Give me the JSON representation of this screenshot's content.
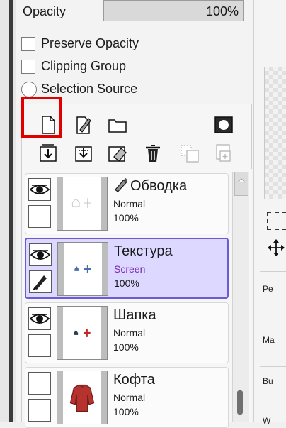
{
  "opacity": {
    "label": "Opacity",
    "value": "100%"
  },
  "options": {
    "preserve_opacity": "Preserve Opacity",
    "clipping_group": "Clipping Group",
    "selection_source": "Selection Source"
  },
  "toolbar": {
    "row1": [
      "new-layer-icon",
      "new-linework-layer-icon",
      "new-folder-icon",
      "layer-mask-icon"
    ],
    "row2": [
      "transfer-down-icon",
      "merge-down-icon",
      "clear-layer-icon",
      "delete-layer-icon",
      "copy-layer-icon",
      "paste-layer-icon"
    ]
  },
  "layers": [
    {
      "name": "Обводка",
      "mode": "Normal",
      "opacity": "100%",
      "visible": true,
      "linework": true,
      "selected": false
    },
    {
      "name": "Текстура",
      "mode": "Screen",
      "opacity": "100%",
      "visible": true,
      "linework": false,
      "selected": true
    },
    {
      "name": "Шапка",
      "mode": "Normal",
      "opacity": "100%",
      "visible": true,
      "linework": false,
      "selected": false
    },
    {
      "name": "Кофта",
      "mode": "Normal",
      "opacity": "100%",
      "visible": false,
      "linework": false,
      "selected": false
    }
  ],
  "right_panel": {
    "labels": [
      "Pe",
      "Ma",
      "Bu",
      "W"
    ]
  },
  "colors": {
    "highlight": "#e00000",
    "selected_bg": "#dcd8ff",
    "selected_border": "#6b5bd6",
    "screen_mode": "#7a28b8"
  }
}
